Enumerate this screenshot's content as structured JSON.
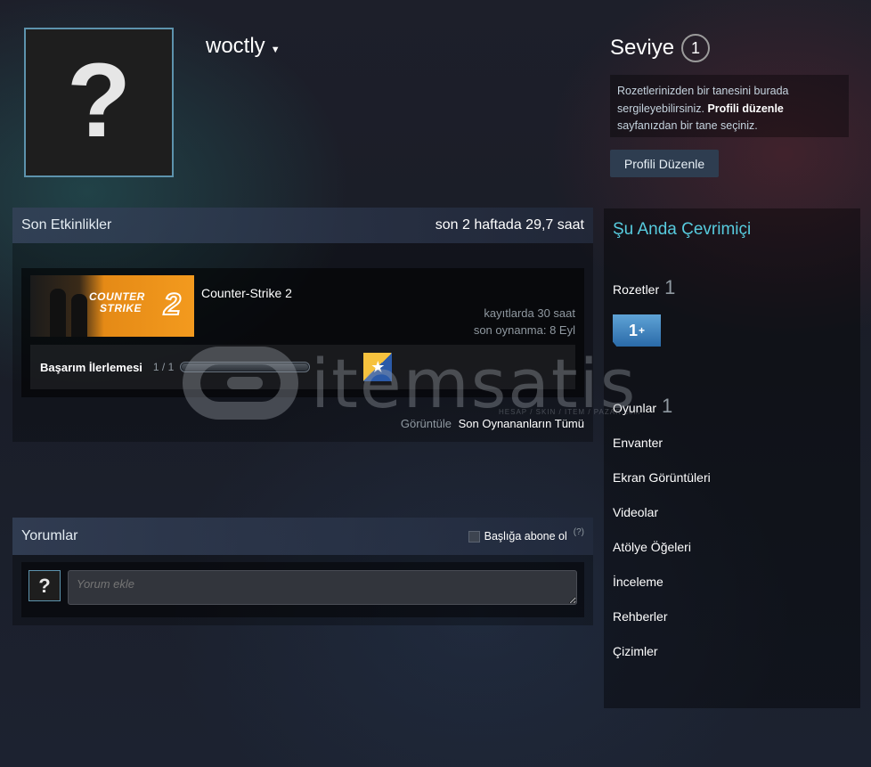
{
  "profile": {
    "username": "woctly",
    "avatar_placeholder": "?"
  },
  "level": {
    "label": "Seviye",
    "value": "1"
  },
  "showcase": {
    "note_text": "Rozetlerinizden bir tanesini burada sergileyebilirsiniz.",
    "note_link": "Profili düzenle",
    "note_suffix": "sayfanızdan bir tane seçiniz."
  },
  "edit_profile_label": "Profili Düzenle",
  "activity": {
    "title": "Son Etkinlikler",
    "summary": "son 2 haftada 29,7 saat",
    "game": {
      "name": "Counter-Strike 2",
      "capsule_text_1": "COUNTER",
      "capsule_text_2": "STRIKE",
      "capsule_number": "2",
      "hours_on_record": "kayıtlarda 30 saat",
      "last_played": "son oynanma: 8 Eyl",
      "achievement_label": "Başarım İlerlemesi",
      "achievement_count": "1 / 1",
      "achievement_progress": 1.0
    },
    "view_prefix": "Görüntüle",
    "view_link": "Son Oynananların Tümü"
  },
  "comments": {
    "title": "Yorumlar",
    "subscribe_label": "Başlığa abone ol",
    "help_label": "(?)",
    "input_placeholder": "Yorum ekle",
    "avatar_placeholder": "?"
  },
  "sidebar": {
    "status": "Şu Anda Çevrimiçi",
    "badges_label": "Rozetler",
    "badges_count": "1",
    "badge_tile_value": "1",
    "badge_tile_plus": "+",
    "games_label": "Oyunlar",
    "games_count": "1",
    "links": [
      "Envanter",
      "Ekran Görüntüleri",
      "Videolar",
      "Atölye Öğeleri",
      "İnceleme",
      "Rehberler",
      "Çizimler"
    ]
  },
  "watermark": {
    "text": "itemsatis",
    "small_text": "HESAP / SKIN / ITEM / PAZAR.com"
  },
  "colors": {
    "accent_online": "#57cbde",
    "avatar_border": "#5d93ad",
    "button_bg": "#2e3d50"
  }
}
